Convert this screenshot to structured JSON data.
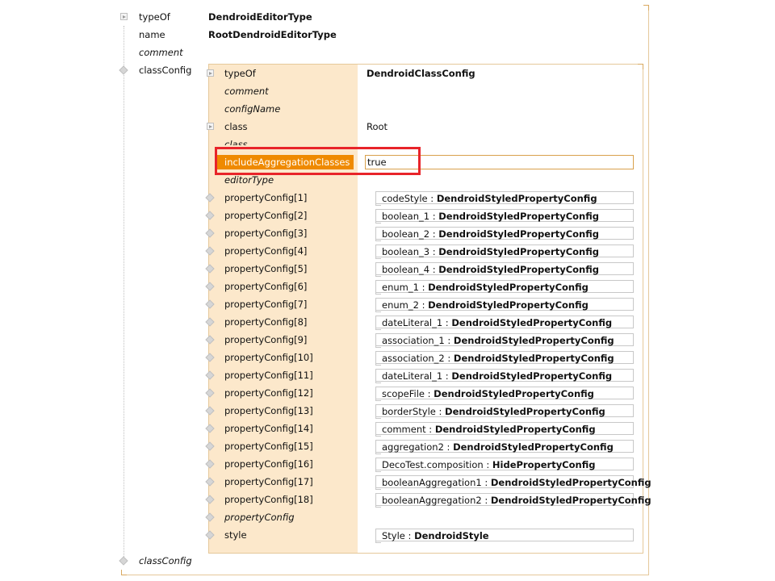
{
  "outer": {
    "typeOf_label": "typeOf",
    "typeOf_value": "DendroidEditorType",
    "name_label": "name",
    "name_value": "RootDendroidEditorType",
    "comment_label": "comment",
    "classConfig_label": "classConfig",
    "classConfig_bottom_label": "classConfig"
  },
  "inner": {
    "typeOf_label": "typeOf",
    "typeOf_value": "DendroidClassConfig",
    "comment_label": "comment",
    "configName_label": "configName",
    "class_label": "class",
    "class_value": "Root",
    "class2_label": "class",
    "include_label": "includeAggregationClasses",
    "include_value": "true",
    "editorType_label": "editorType",
    "propertyConfig_empty_label": "propertyConfig",
    "style_label": "style",
    "style_name": "Style",
    "style_type": "DendroidStyle",
    "separator": " : ",
    "properties": [
      {
        "label": "propertyConfig[1]",
        "name": "codeStyle",
        "type": "DendroidStyledPropertyConfig"
      },
      {
        "label": "propertyConfig[2]",
        "name": "boolean_1",
        "type": "DendroidStyledPropertyConfig"
      },
      {
        "label": "propertyConfig[3]",
        "name": "boolean_2",
        "type": "DendroidStyledPropertyConfig"
      },
      {
        "label": "propertyConfig[4]",
        "name": "boolean_3",
        "type": "DendroidStyledPropertyConfig"
      },
      {
        "label": "propertyConfig[5]",
        "name": "boolean_4",
        "type": "DendroidStyledPropertyConfig"
      },
      {
        "label": "propertyConfig[6]",
        "name": "enum_1",
        "type": "DendroidStyledPropertyConfig"
      },
      {
        "label": "propertyConfig[7]",
        "name": "enum_2",
        "type": "DendroidStyledPropertyConfig"
      },
      {
        "label": "propertyConfig[8]",
        "name": "dateLiteral_1",
        "type": "DendroidStyledPropertyConfig"
      },
      {
        "label": "propertyConfig[9]",
        "name": "association_1",
        "type": "DendroidStyledPropertyConfig"
      },
      {
        "label": "propertyConfig[10]",
        "name": "association_2",
        "type": "DendroidStyledPropertyConfig"
      },
      {
        "label": "propertyConfig[11]",
        "name": "dateLiteral_1",
        "type": "DendroidStyledPropertyConfig"
      },
      {
        "label": "propertyConfig[12]",
        "name": "scopeFile",
        "type": "DendroidStyledPropertyConfig"
      },
      {
        "label": "propertyConfig[13]",
        "name": "borderStyle",
        "type": "DendroidStyledPropertyConfig"
      },
      {
        "label": "propertyConfig[14]",
        "name": "comment",
        "type": "DendroidStyledPropertyConfig"
      },
      {
        "label": "propertyConfig[15]",
        "name": "aggregation2",
        "type": "DendroidStyledPropertyConfig"
      },
      {
        "label": "propertyConfig[16]",
        "name": "DecoTest.composition",
        "type": "HidePropertyConfig"
      },
      {
        "label": "propertyConfig[17]",
        "name": "booleanAggregation1",
        "type": "DendroidStyledPropertyConfig"
      },
      {
        "label": "propertyConfig[18]",
        "name": "booleanAggregation2",
        "type": "DendroidStyledPropertyConfig"
      }
    ]
  },
  "colors": {
    "selection": "#ef8a00",
    "label_column": "#fce8cb",
    "highlight": "#e8242a",
    "border": "#e5c89a"
  }
}
